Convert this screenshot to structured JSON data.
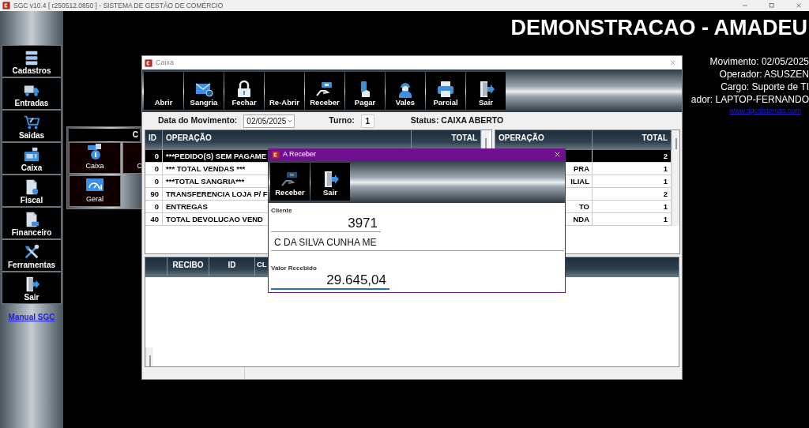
{
  "window": {
    "title": "SGC v10.4 [ r250512.0850 ] - SISTEMA DE GESTÃO DE COMÉRCIO"
  },
  "sidebar": {
    "items": [
      {
        "label": "Cadastros"
      },
      {
        "label": "Entradas"
      },
      {
        "label": "Saidas"
      },
      {
        "label": "Caixa"
      },
      {
        "label": "Fiscal"
      },
      {
        "label": "Financeiro"
      },
      {
        "label": "Ferramentas"
      },
      {
        "label": "Sair"
      }
    ],
    "link": "Manual SGC"
  },
  "header": {
    "company": "DEMONSTRACAO - AMADEU",
    "info": [
      "Movimento: 02/05/2025",
      "Operador: ASUSZEN",
      "Cargo: Suporte de TI",
      "ador: LAPTOP-FERNANDO"
    ],
    "website": "www.sgcsistemas.com"
  },
  "submenu": {
    "title": "C",
    "tiles": [
      {
        "label": "Caixa"
      },
      {
        "label": "C"
      },
      {
        "label": "Geral"
      }
    ]
  },
  "caixa": {
    "title": "Caixa",
    "toolbar": [
      {
        "label": "Abrir"
      },
      {
        "label": "Sangria"
      },
      {
        "label": "Fechar"
      },
      {
        "label": "Re-Abrir"
      },
      {
        "label": "Receber"
      },
      {
        "label": "Pagar"
      },
      {
        "label": "Vales"
      },
      {
        "label": "Parcial"
      },
      {
        "label": "Sair"
      }
    ],
    "movement_date_label": "Data do Movimento:",
    "movement_date": "02/05/2025",
    "shift_label": "Turno:",
    "shift": "1",
    "status": "Status: CAIXA ABERTO",
    "operations_table": {
      "columns": [
        "ID",
        "OPERAÇÃO",
        "TOTAL"
      ],
      "rows": [
        {
          "id": "0",
          "operation": "***PEDIDO(S) SEM PAGAME",
          "selected": true
        },
        {
          "id": "0",
          "operation": "*** TOTAL VENDAS ***",
          "selected": false
        },
        {
          "id": "0",
          "operation": "***TOTAL SANGRIA***",
          "selected": false
        },
        {
          "id": "90",
          "operation": "TRANSFERENCIA LOJA P/ F",
          "selected": false
        },
        {
          "id": "0",
          "operation": "ENTREGAS",
          "selected": false
        },
        {
          "id": "40",
          "operation": "TOTAL DEVOLUCAO VEND",
          "selected": false
        }
      ]
    },
    "summary_table": {
      "columns": [
        "OPERAÇÃO",
        "TOTAL"
      ],
      "rows": [
        {
          "total": "2",
          "selected": true
        },
        {
          "operation": "PRA",
          "total": "1",
          "selected": false
        },
        {
          "operation": "ILIAL",
          "total": "1",
          "selected": false
        },
        {
          "total": "2",
          "selected": false
        },
        {
          "operation": "TO",
          "total": "1",
          "selected": false
        },
        {
          "operation": "NDA",
          "total": "1",
          "selected": false
        }
      ]
    },
    "receipts_table": {
      "columns": [
        "RECIBO",
        "ID",
        "CL"
      ]
    }
  },
  "dialog": {
    "title": "A Receber",
    "toolbar": [
      {
        "label": "Receber"
      },
      {
        "label": "Sair"
      }
    ],
    "client_label": "Cliente",
    "client_code": "3971",
    "client_name": "C DA SILVA CUNHA ME",
    "amount_label": "Valor Recebido",
    "amount": "29.645,04"
  }
}
